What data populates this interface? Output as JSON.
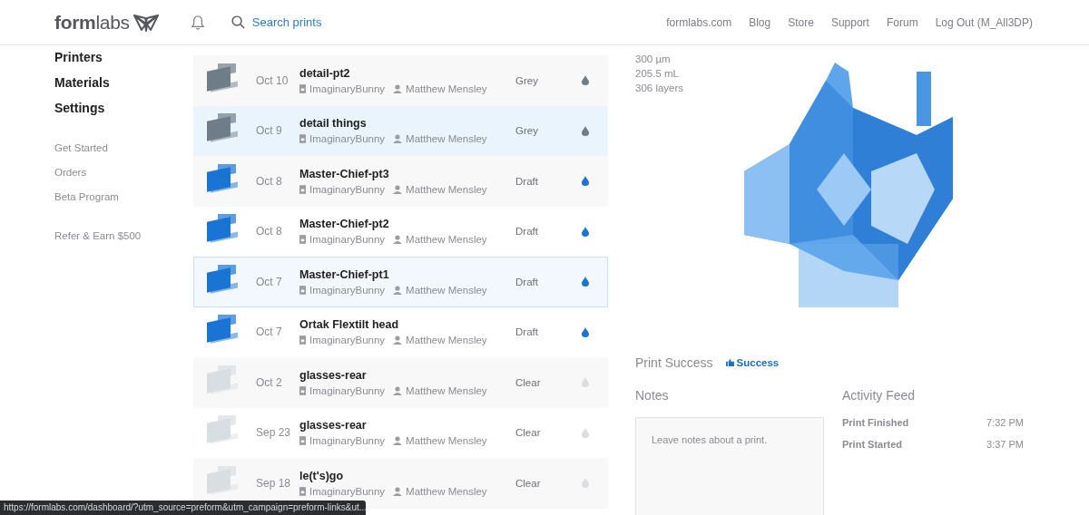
{
  "header": {
    "logo": "**form**labs",
    "search": {
      "placeholder": "Search prints"
    },
    "nav": [
      "formlabs.com",
      "Blog",
      "Store",
      "Support",
      "Forum",
      "Log Out (M_All3DP)"
    ]
  },
  "sidebar": {
    "main": [
      "Printers",
      "Materials",
      "Settings"
    ],
    "secondary": [
      "Get Started",
      "Orders",
      "Beta Program"
    ],
    "promo": "Refer & Earn $500"
  },
  "prints": [
    {
      "date": "Oct 10",
      "name": "detail-pt2",
      "printer": "ImaginaryBunny",
      "user": "Matthew Mensley",
      "resin": "Grey",
      "color": "#6e7d88",
      "selected": false,
      "hovered": false
    },
    {
      "date": "Oct 9",
      "name": "detail things",
      "printer": "ImaginaryBunny",
      "user": "Matthew Mensley",
      "resin": "Grey",
      "color": "#6e7d88",
      "selected": false,
      "hovered": true
    },
    {
      "date": "Oct 8",
      "name": "Master-Chief-pt3",
      "printer": "ImaginaryBunny",
      "user": "Matthew Mensley",
      "resin": "Draft",
      "color": "#1a74d4",
      "selected": false,
      "hovered": false
    },
    {
      "date": "Oct 8",
      "name": "Master-Chief-pt2",
      "printer": "ImaginaryBunny",
      "user": "Matthew Mensley",
      "resin": "Draft",
      "color": "#1a74d4",
      "selected": false,
      "hovered": false
    },
    {
      "date": "Oct 7",
      "name": "Master-Chief-pt1",
      "printer": "ImaginaryBunny",
      "user": "Matthew Mensley",
      "resin": "Draft",
      "color": "#1a74d4",
      "selected": true,
      "hovered": false
    },
    {
      "date": "Oct 7",
      "name": "Ortak Flextilt head",
      "printer": "ImaginaryBunny",
      "user": "Matthew Mensley",
      "resin": "Draft",
      "color": "#1a74d4",
      "selected": false,
      "hovered": false
    },
    {
      "date": "Oct 2",
      "name": "glasses-rear",
      "printer": "ImaginaryBunny",
      "user": "Matthew Mensley",
      "resin": "Clear",
      "color": "#d9dee3",
      "selected": false,
      "hovered": false
    },
    {
      "date": "Sep 23",
      "name": "glasses-rear",
      "printer": "ImaginaryBunny",
      "user": "Matthew Mensley",
      "resin": "Clear",
      "color": "#d9dee3",
      "selected": false,
      "hovered": false
    },
    {
      "date": "Sep 18",
      "name": "le(t's)go",
      "printer": "ImaginaryBunny",
      "user": "Matthew Mensley",
      "resin": "Clear",
      "color": "#d9dee3",
      "selected": false,
      "hovered": false
    }
  ],
  "details": {
    "stats": [
      "300 µm",
      "205.5 mL",
      "306 layers"
    ],
    "result_label": "Print Success",
    "result": "Success",
    "notes_title": "Notes",
    "notes": {
      "placeholder": "Leave notes about a print."
    },
    "activity_title": "Activity Feed",
    "activity": [
      {
        "event": "Print Finished",
        "time": "7:32 PM"
      },
      {
        "event": "Print Started",
        "time": "3:37 PM"
      }
    ]
  },
  "status_url": "https://formlabs.com/dashboard/?utm_source=preform&utm_campaign=preform-links&ut..."
}
